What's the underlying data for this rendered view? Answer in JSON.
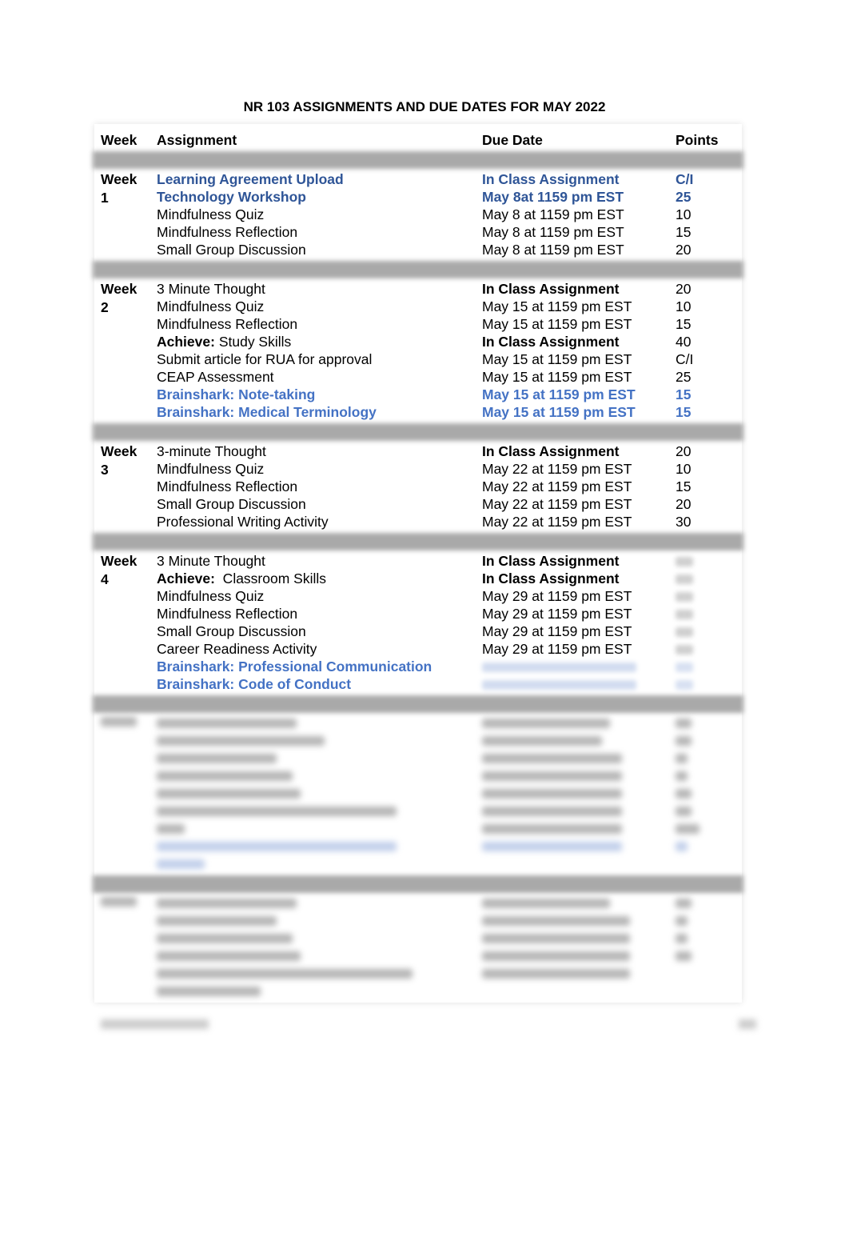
{
  "document": {
    "title": "NR 103 ASSIGNMENTS AND DUE DATES FOR MAY 2022"
  },
  "table": {
    "headers": [
      "Week",
      "Assignment",
      "Due Date",
      "Points"
    ],
    "weeks": [
      {
        "label": "Week 1",
        "rows": [
          {
            "assignment": "Learning Agreement Upload",
            "due": "In Class Assignment",
            "points": "C/I",
            "style": "blue-dark"
          },
          {
            "assignment": "Technology Workshop",
            "due": "May 8at 1159 pm EST",
            "points": "25",
            "style": "blue-dark"
          },
          {
            "assignment": "Mindfulness Quiz",
            "due": "May 8 at 1159 pm EST",
            "points": "10",
            "style": "normal"
          },
          {
            "assignment": "Mindfulness Reflection",
            "due": "May 8 at 1159 pm EST",
            "points": "15",
            "style": "normal"
          },
          {
            "assignment": "Small Group Discussion",
            "due": "May 8 at 1159 pm EST",
            "points": "20",
            "style": "normal"
          }
        ]
      },
      {
        "label": "Week 2",
        "rows": [
          {
            "assignment": "3 Minute Thought",
            "due": "In Class Assignment",
            "points": "20",
            "style": "due-bold"
          },
          {
            "assignment": "Mindfulness Quiz",
            "due": "May 15 at 1159 pm EST",
            "points": "10",
            "style": "normal"
          },
          {
            "assignment": "Mindfulness Reflection",
            "due": "May 15 at 1159 pm EST",
            "points": "15",
            "style": "normal"
          },
          {
            "assignment_prefix": "Achieve:",
            "assignment": " Study Skills",
            "due": "In Class Assignment",
            "points": "40",
            "style": "due-bold"
          },
          {
            "assignment": "Submit article for RUA for approval",
            "due": "May 15 at 1159 pm EST",
            "points": "C/I",
            "style": "normal"
          },
          {
            "assignment": "CEAP Assessment",
            "due": "May 15 at 1159 pm EST",
            "points": "25",
            "style": "normal"
          },
          {
            "assignment": "Brainshark: Note-taking",
            "due": "May 15 at 1159 pm EST",
            "points": "15",
            "style": "blue"
          },
          {
            "assignment": "Brainshark: Medical Terminology",
            "due": "May 15 at 1159 pm EST",
            "points": "15",
            "style": "blue"
          }
        ]
      },
      {
        "label": "Week 3",
        "rows": [
          {
            "assignment": "3-minute Thought",
            "due": "In Class Assignment",
            "points": "20",
            "style": "due-bold"
          },
          {
            "assignment": "Mindfulness Quiz",
            "due": "May 22 at 1159 pm EST",
            "points": "10",
            "style": "normal"
          },
          {
            "assignment": "Mindfulness Reflection",
            "due": "May 22 at 1159 pm EST",
            "points": "15",
            "style": "normal"
          },
          {
            "assignment": "Small Group Discussion",
            "due": "May 22 at 1159 pm EST",
            "points": "20",
            "style": "normal"
          },
          {
            "assignment": "Professional Writing Activity",
            "due": "May 22 at 1159 pm EST",
            "points": "30",
            "style": "normal"
          }
        ]
      },
      {
        "label": "Week 4",
        "rows": [
          {
            "assignment": "3 Minute Thought",
            "due": "In Class Assignment",
            "points": "",
            "style": "due-bold"
          },
          {
            "assignment_prefix": "Achieve:",
            "assignment": "  Classroom Skills",
            "due": "In Class Assignment",
            "points": "",
            "style": "due-bold"
          },
          {
            "assignment": "Mindfulness Quiz",
            "due": "May 29 at 1159 pm EST",
            "points": "",
            "style": "normal"
          },
          {
            "assignment": "Mindfulness Reflection",
            "due": "May 29 at 1159 pm EST",
            "points": "",
            "style": "normal"
          },
          {
            "assignment": "Small Group Discussion",
            "due": "May 29 at 1159 pm EST",
            "points": "",
            "style": "normal"
          },
          {
            "assignment": "Career Readiness Activity",
            "due": "May 29 at 1159 pm EST",
            "points": "",
            "style": "normal"
          },
          {
            "assignment": "Brainshark: Professional Communication",
            "due": "",
            "points": "",
            "style": "blue"
          },
          {
            "assignment": "Brainshark: Code of Conduct",
            "due": "",
            "points": "",
            "style": "blue"
          }
        ]
      }
    ]
  }
}
